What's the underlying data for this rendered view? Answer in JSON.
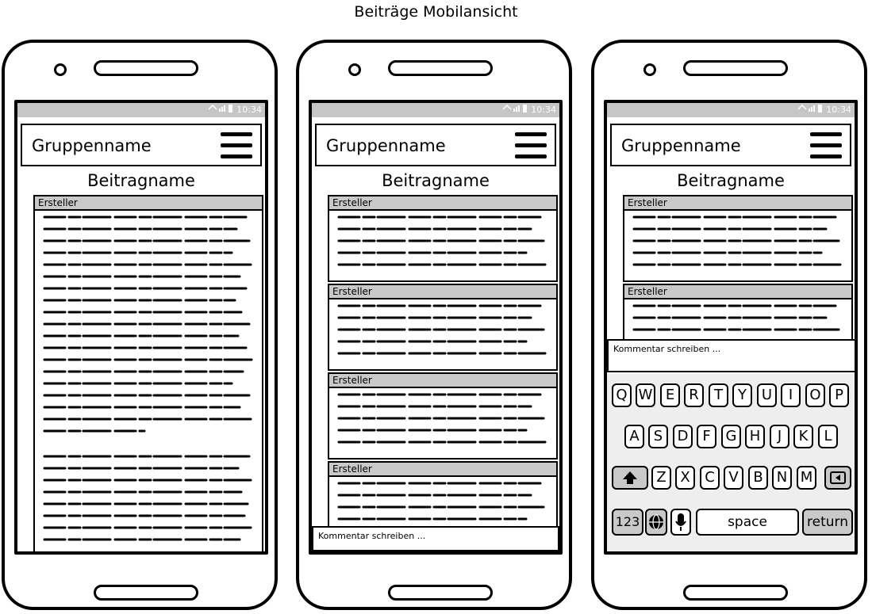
{
  "page": {
    "title": "Beiträge Mobilansicht"
  },
  "status_bar": {
    "time": "10:34"
  },
  "app_bar": {
    "group_name": "Gruppenname",
    "menu_icon": "hamburger-menu-icon"
  },
  "post": {
    "title": "Beitragname",
    "author_label": "Ersteller"
  },
  "comment": {
    "placeholder": "Kommentar schreiben ..."
  },
  "keyboard": {
    "row1": [
      "Q",
      "W",
      "E",
      "R",
      "T",
      "Y",
      "U",
      "I",
      "O",
      "P"
    ],
    "row2": [
      "A",
      "S",
      "D",
      "F",
      "G",
      "H",
      "J",
      "K",
      "L"
    ],
    "row3": [
      "Z",
      "X",
      "C",
      "V",
      "B",
      "N",
      "M"
    ],
    "num_label": "123",
    "space_label": "space",
    "return_label": "return",
    "shift_icon": "shift-arrow-icon",
    "backspace_icon": "backspace-icon",
    "globe_icon": "globe-icon",
    "mic_icon": "microphone-icon"
  },
  "colors": {
    "header_gray": "#c9c9c9",
    "status_gray": "#c6c6c6",
    "keyboard_bg": "#eeeeee"
  }
}
